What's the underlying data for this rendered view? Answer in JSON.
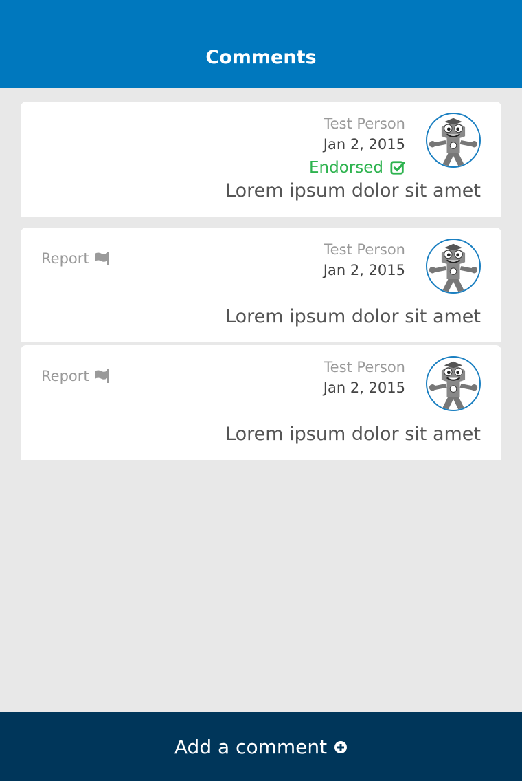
{
  "header": {
    "title": "Comments"
  },
  "comments": [
    {
      "author": "Test Person",
      "date": "Jan 2, 2015",
      "endorsed_label": "Endorsed",
      "body": "Lorem ipsum dolor sit amet",
      "avatar_icon": "mascot-avatar-icon",
      "endorsed_icon": "check-square-icon"
    },
    {
      "author": "Test Person",
      "date": "Jan 2, 2015",
      "report_label": "Report",
      "body": "Lorem ipsum dolor sit amet",
      "avatar_icon": "mascot-avatar-icon",
      "report_icon": "flag-icon"
    },
    {
      "author": "Test Person",
      "date": "Jan 2, 2015",
      "report_label": "Report",
      "body": "Lorem ipsum dolor sit amet",
      "avatar_icon": "mascot-avatar-icon",
      "report_icon": "flag-icon"
    }
  ],
  "footer": {
    "add_label": "Add a comment",
    "add_icon": "plus-circle-icon"
  },
  "colors": {
    "header": "#0078be",
    "footer": "#00365a",
    "endorsed": "#2eb34f",
    "background": "#e8e8e8",
    "avatar_ring": "#1a7fc1"
  }
}
